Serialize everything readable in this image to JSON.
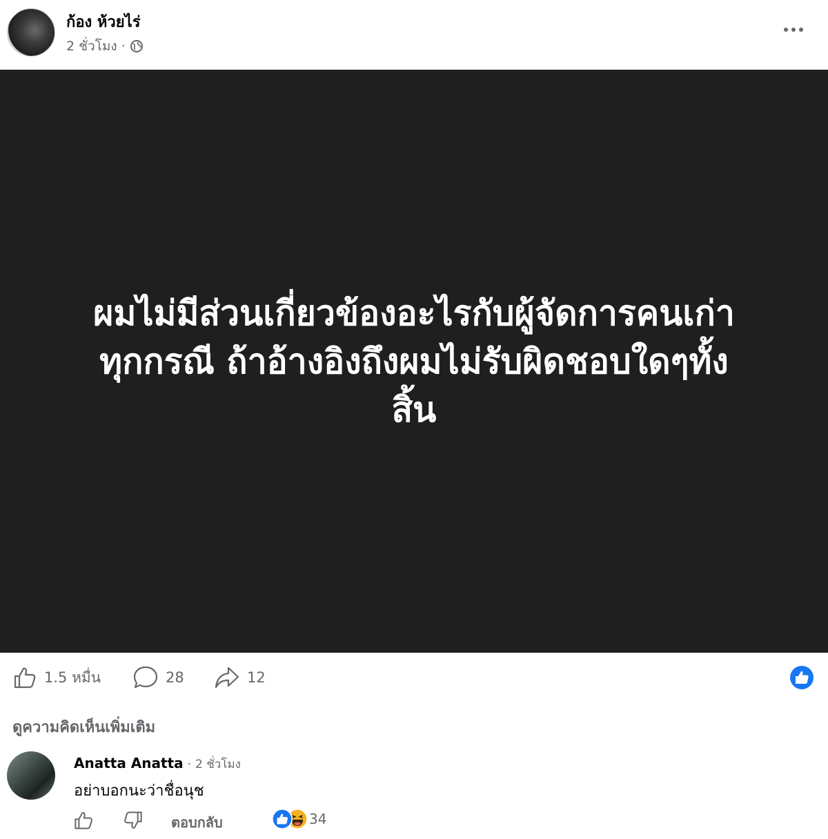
{
  "post": {
    "author": "ก้อง ห้วยไร่",
    "time": "2 ชั่วโมง",
    "separator": "·",
    "privacy_icon": "globe-icon",
    "image_text_lines": [
      "ผมไม่มีส่วนเกี่ยวข้องอะไรกับผู้จัดการคนเก่า",
      "ทุกกรณี ถ้าอ้างอิงถึงผมไม่รับผิดชอบใดๆทั้ง",
      "สิ้น"
    ]
  },
  "actions": {
    "likes": "1.5 หมื่น",
    "comments": "28",
    "shares": "12"
  },
  "more_comments_label": "ดูความคิดเห็นเพิ่มเติม",
  "comment": {
    "author": "Anatta Anatta",
    "separator": "·",
    "time": "2 ชั่วโมง",
    "text": "อย่าบอกนะว่าชื่อนุช",
    "reply_label": "ตอบกลับ",
    "reaction_count": "34"
  },
  "colors": {
    "image_bg": "#1f1f1f",
    "meta_gray": "#65676b",
    "like_blue": "#1877f2",
    "haha_yellow": "#f7b125"
  }
}
